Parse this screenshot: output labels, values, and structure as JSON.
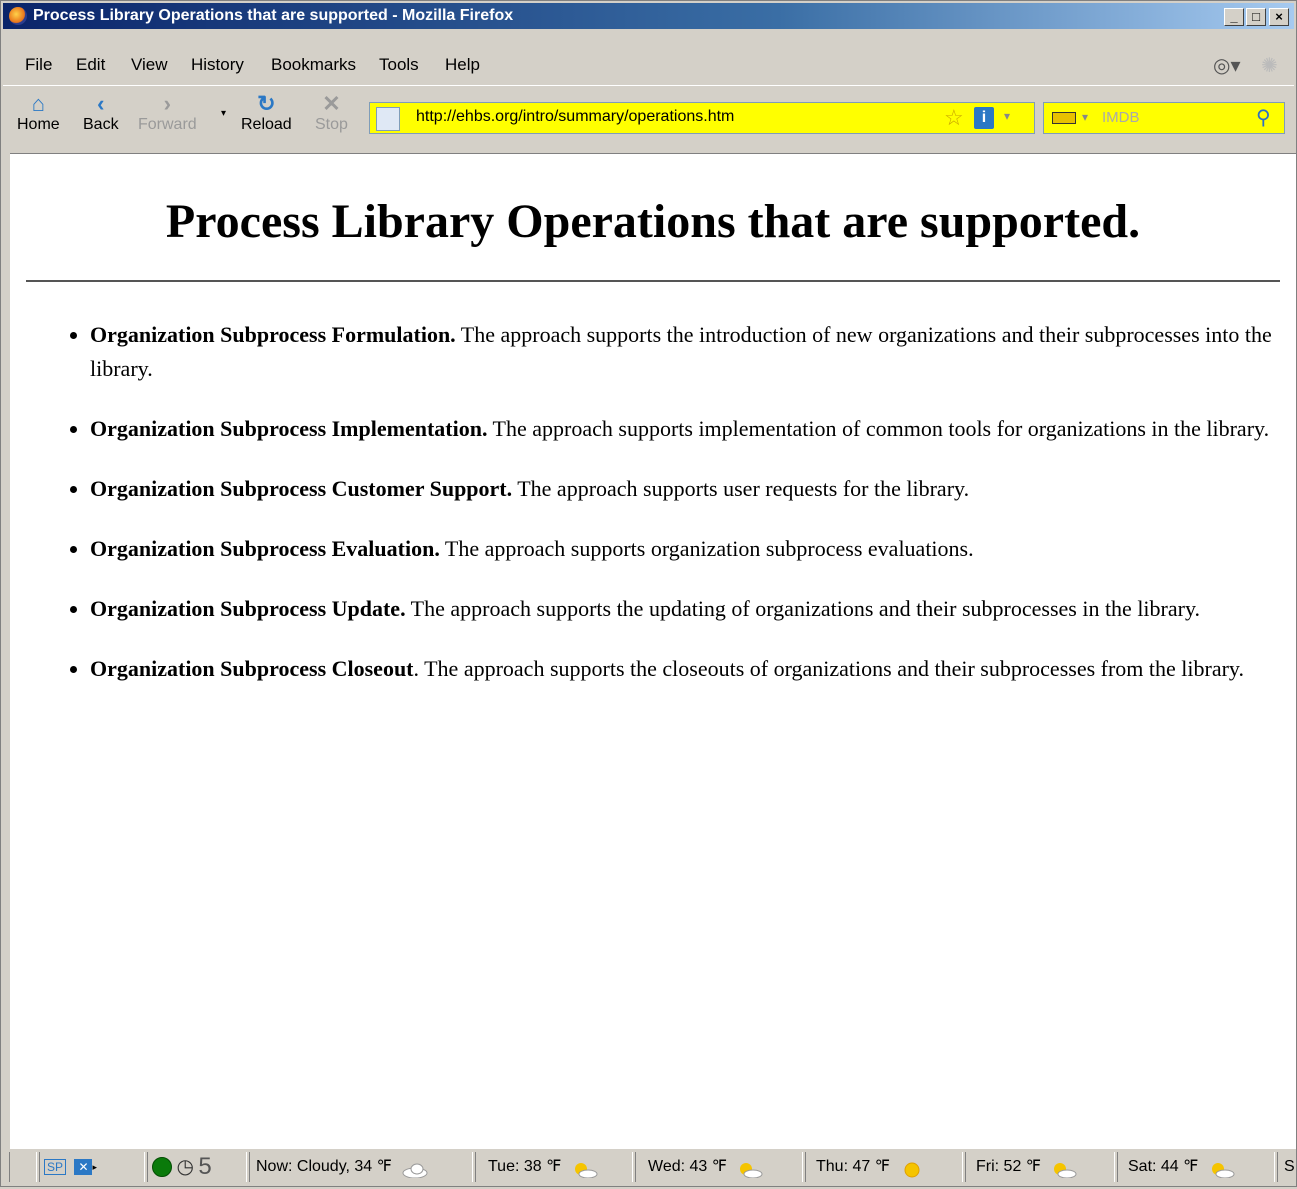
{
  "window": {
    "title": "Process Library Operations that are supported - Mozilla Firefox"
  },
  "menu": {
    "items": [
      "File",
      "Edit",
      "View",
      "History",
      "Bookmarks",
      "Tools",
      "Help"
    ]
  },
  "nav": {
    "home": "Home",
    "back": "Back",
    "forward": "Forward",
    "reload": "Reload",
    "stop": "Stop",
    "url": "http://ehbs.org/intro/summary/operations.htm",
    "search_placeholder": "IMDB"
  },
  "page": {
    "heading": "Process Library Operations that are supported.",
    "items": [
      {
        "term": "Organization Subprocess Formulation.",
        "desc": " The approach supports the introduction of new organizations and their subprocesses into the library."
      },
      {
        "term": "Organization Subprocess Implementation.",
        "desc": " The approach supports implementation of common tools for organizations in the library."
      },
      {
        "term": "Organization Subprocess Customer Support.",
        "desc": " The approach supports user requests for the library."
      },
      {
        "term": "Organization Subprocess Evaluation.",
        "desc": " The approach supports organization subprocess evaluations."
      },
      {
        "term": "Organization Subprocess Update.",
        "desc": " The approach supports the updating of organizations and their subprocesses in the library."
      },
      {
        "term": "Organization Subprocess Closeout",
        "desc": ". The approach supports the closeouts of organizations and their subprocesses from the library."
      }
    ]
  },
  "status": {
    "sp": "SP",
    "count": "5",
    "now": "Now: Cloudy, 34 ℉",
    "tue": "Tue: 38 ℉",
    "wed": "Wed: 43 ℉",
    "thu": "Thu: 47 ℉",
    "fri": "Fri: 52 ℉",
    "sat": "Sat: 44 ℉",
    "more": "S"
  }
}
